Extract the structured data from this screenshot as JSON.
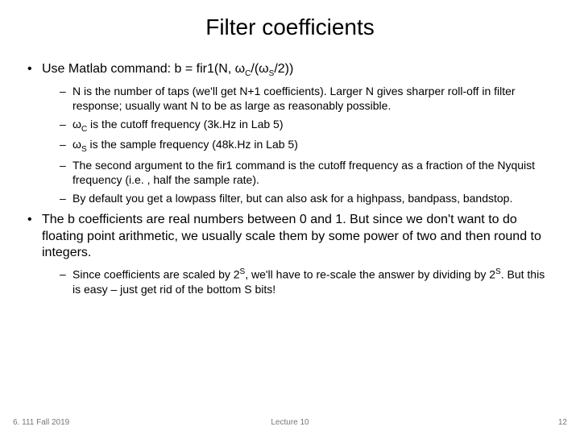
{
  "title": "Filter coefficients",
  "b1": {
    "pre": "Use Matlab command: b = fir1(N, ω",
    "sub1": "C",
    "mid1": "/(ω",
    "sub2": "S",
    "post": "/2))"
  },
  "s1a": "N is the number of taps (we'll get N+1 coefficients).  Larger N gives sharper roll-off in filter response; usually want N to be as large as reasonably possible.",
  "s1b": {
    "pre": "ω",
    "sub": "C",
    "post": " is the cutoff frequency (3k.Hz in Lab 5)"
  },
  "s1c": {
    "pre": "ω",
    "sub": "S",
    "post": " is the sample frequency (48k.Hz in Lab 5)"
  },
  "s1d": "The second argument to the fir1 command is the cutoff frequency as a fraction of the Nyquist frequency (i.e. , half the sample rate).",
  "s1e": "By default you get a lowpass filter, but can also ask for a highpass, bandpass, bandstop.",
  "b2": "The b coefficients are real numbers between 0 and 1.  But since we don't want to do floating point arithmetic, we usually scale them by some power of two and then round to integers.",
  "s2a": {
    "pre": "Since coefficients are scaled by 2",
    "sup1": "S",
    "mid": ", we'll have to re-scale the answer by dividing by 2",
    "sup2": "S",
    "post": ".  But this is easy – just get rid of the bottom S bits!"
  },
  "footer": {
    "left": "6. 111 Fall 2019",
    "center": "Lecture 10",
    "right": "12"
  }
}
